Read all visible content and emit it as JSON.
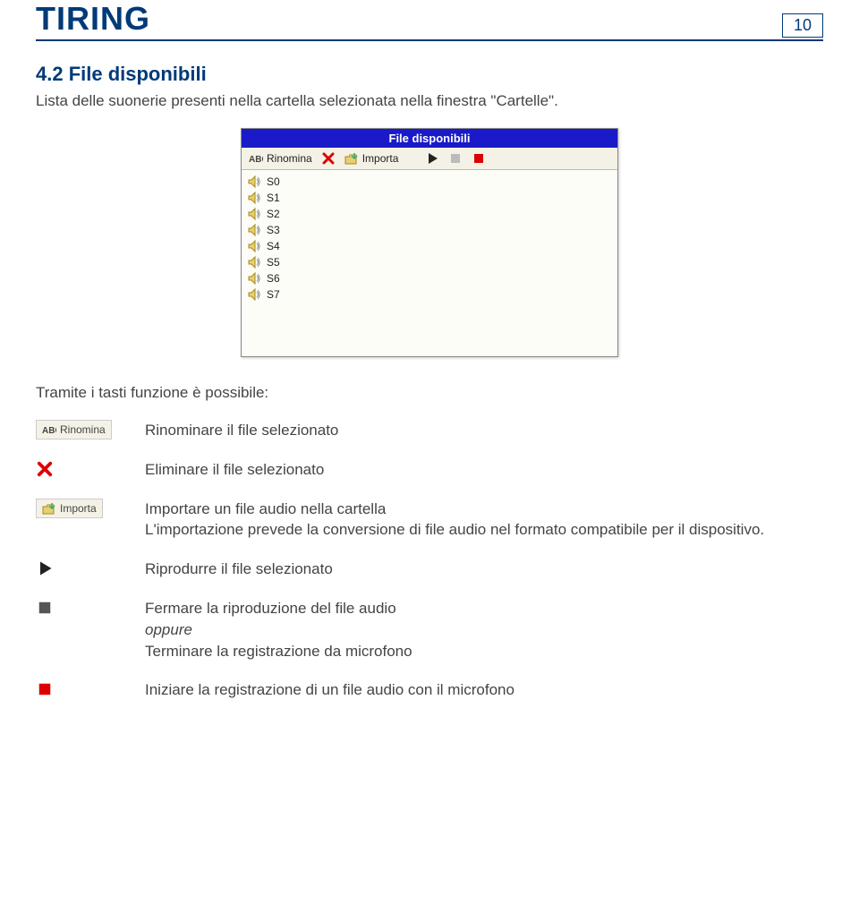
{
  "header": {
    "brand": "TIRING",
    "page_number": "10"
  },
  "section": {
    "number_title": "4.2 File disponibili",
    "intro": "Lista delle suonerie presenti nella cartella selezionata nella finestra \"Cartelle\"."
  },
  "panel": {
    "title": "File disponibili",
    "toolbar": {
      "rename": "Rinomina",
      "import": "Importa"
    },
    "files": [
      "S0",
      "S1",
      "S2",
      "S3",
      "S4",
      "S5",
      "S6",
      "S7"
    ]
  },
  "definitions": {
    "intro": "Tramite i tasti funzione è possibile:",
    "rename_label": "Rinomina",
    "rename_text": "Rinominare il file selezionato",
    "delete_text": "Eliminare il file selezionato",
    "import_label": "Importa",
    "import_text_line1": "Importare un file audio nella cartella",
    "import_text_line2": "L'importazione prevede la conversione di file audio nel formato compatibile per il dispositivo.",
    "play_text": "Riprodurre il file selezionato",
    "stop_line1": "Fermare la riproduzione del file audio",
    "stop_line2": "oppure",
    "stop_line3": "Terminare la registrazione da microfono",
    "record_text": "Iniziare la registrazione di un file audio con il microfono"
  }
}
